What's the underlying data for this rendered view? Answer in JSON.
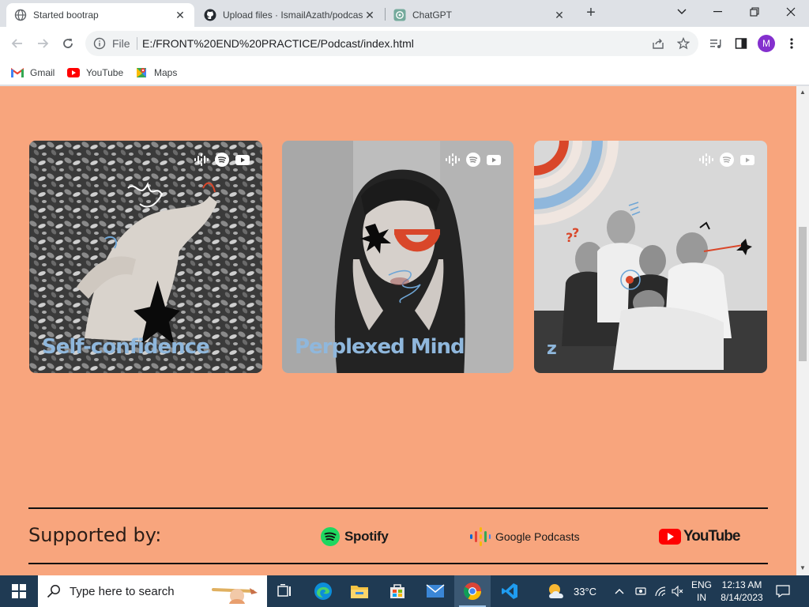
{
  "browser": {
    "tabs": [
      {
        "title": "Started bootrap",
        "icon": "globe-icon",
        "active": true
      },
      {
        "title": "Upload files · IsmailAzath/podcas",
        "icon": "github-icon",
        "active": false
      },
      {
        "title": "ChatGPT",
        "icon": "chatgpt-icon",
        "active": false
      }
    ],
    "address": {
      "scheme_label": "File",
      "url": "E:/FRONT%20END%20PRACTICE/Podcast/index.html"
    },
    "profile_initial": "M",
    "bookmarks": [
      {
        "label": "Gmail",
        "icon": "gmail-icon"
      },
      {
        "label": "YouTube",
        "icon": "youtube-icon"
      },
      {
        "label": "Maps",
        "icon": "maps-icon"
      }
    ]
  },
  "page": {
    "background": "#f8a57d",
    "cards": [
      {
        "title": "Self-confidence",
        "platform_icons": [
          "google-podcasts-icon",
          "spotify-icon",
          "youtube-icon"
        ]
      },
      {
        "title": "Perplexed Mind",
        "platform_icons": [
          "google-podcasts-icon",
          "spotify-icon",
          "youtube-icon"
        ]
      },
      {
        "title": "z",
        "platform_icons": [
          "google-podcasts-icon",
          "spotify-icon",
          "youtube-icon"
        ]
      }
    ],
    "footer": {
      "supported_label": "Supported by:",
      "sponsors": [
        {
          "label": "Spotify",
          "icon": "spotify-logo"
        },
        {
          "label": "Google Podcasts",
          "icon": "google-podcasts-logo"
        },
        {
          "label": "YouTube",
          "icon": "youtube-logo"
        }
      ]
    }
  },
  "taskbar": {
    "search_placeholder": "Type here to search",
    "apps": [
      "task-view-icon",
      "edge-icon",
      "file-explorer-icon",
      "store-icon",
      "mail-icon",
      "chrome-icon",
      "vscode-icon"
    ],
    "weather": "33°C",
    "language_line1": "ENG",
    "language_line2": "IN",
    "time": "12:13 AM",
    "date": "8/14/2023"
  }
}
